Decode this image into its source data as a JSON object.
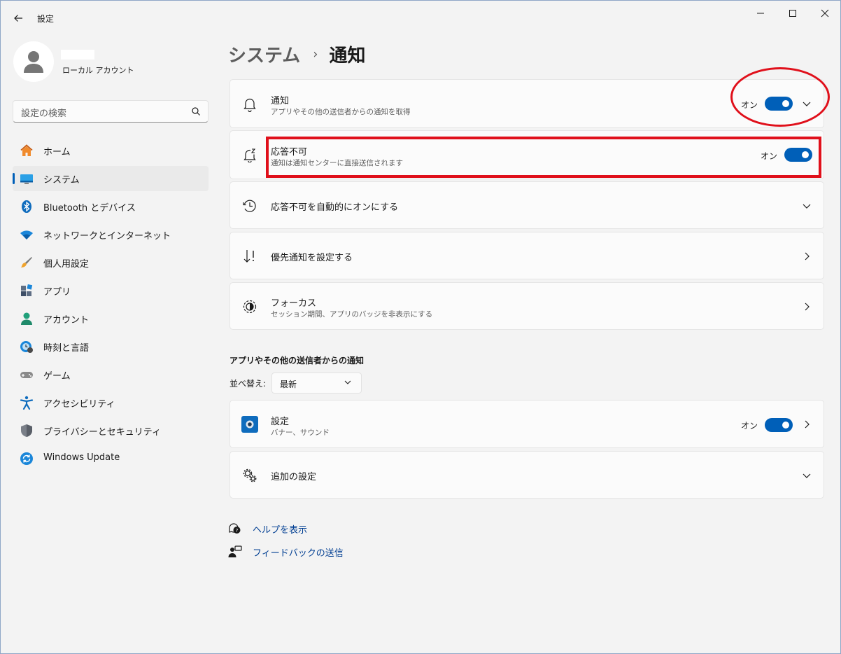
{
  "window": {
    "title": "設定"
  },
  "profile": {
    "account_type": "ローカル アカウント"
  },
  "search": {
    "placeholder": "設定の検索"
  },
  "sidebar": {
    "items": [
      {
        "label": "ホーム",
        "icon": "home-icon"
      },
      {
        "label": "システム",
        "icon": "system-icon",
        "active": true
      },
      {
        "label": "Bluetooth とデバイス",
        "icon": "bluetooth-icon"
      },
      {
        "label": "ネットワークとインターネット",
        "icon": "wifi-icon"
      },
      {
        "label": "個人用設定",
        "icon": "brush-icon"
      },
      {
        "label": "アプリ",
        "icon": "apps-icon"
      },
      {
        "label": "アカウント",
        "icon": "account-icon"
      },
      {
        "label": "時刻と言語",
        "icon": "time-language-icon"
      },
      {
        "label": "ゲーム",
        "icon": "gamepad-icon"
      },
      {
        "label": "アクセシビリティ",
        "icon": "accessibility-icon"
      },
      {
        "label": "プライバシーとセキュリティ",
        "icon": "shield-icon"
      },
      {
        "label": "Windows Update",
        "icon": "windows-update-icon"
      }
    ]
  },
  "breadcrumb": {
    "parent": "システム",
    "separator": "›",
    "current": "通知"
  },
  "cards": {
    "notifications": {
      "title": "通知",
      "subtitle": "アプリやその他の送信者からの通知を取得",
      "toggle_label": "オン",
      "toggle_on": true
    },
    "dnd": {
      "title": "応答不可",
      "subtitle": "通知は通知センターに直接送信されます",
      "toggle_label": "オン",
      "toggle_on": true
    },
    "auto_dnd": {
      "title": "応答不可を自動的にオンにする"
    },
    "priority": {
      "title": "優先通知を設定する"
    },
    "focus": {
      "title": "フォーカス",
      "subtitle": "セッション期間、アプリのバッジを非表示にする"
    }
  },
  "app_section": {
    "title": "アプリやその他の送信者からの通知",
    "sort_label": "並べ替え:",
    "sort_value": "最新",
    "apps": [
      {
        "title": "設定",
        "subtitle": "バナー、サウンド",
        "toggle_label": "オン",
        "toggle_on": true
      }
    ],
    "additional": {
      "title": "追加の設定"
    }
  },
  "links": {
    "help": "ヘルプを表示",
    "feedback": "フィードバックの送信"
  },
  "colors": {
    "accent": "#005fb8",
    "annotation": "#e0101b",
    "background": "#f3f3f3",
    "card": "#fbfbfb"
  }
}
